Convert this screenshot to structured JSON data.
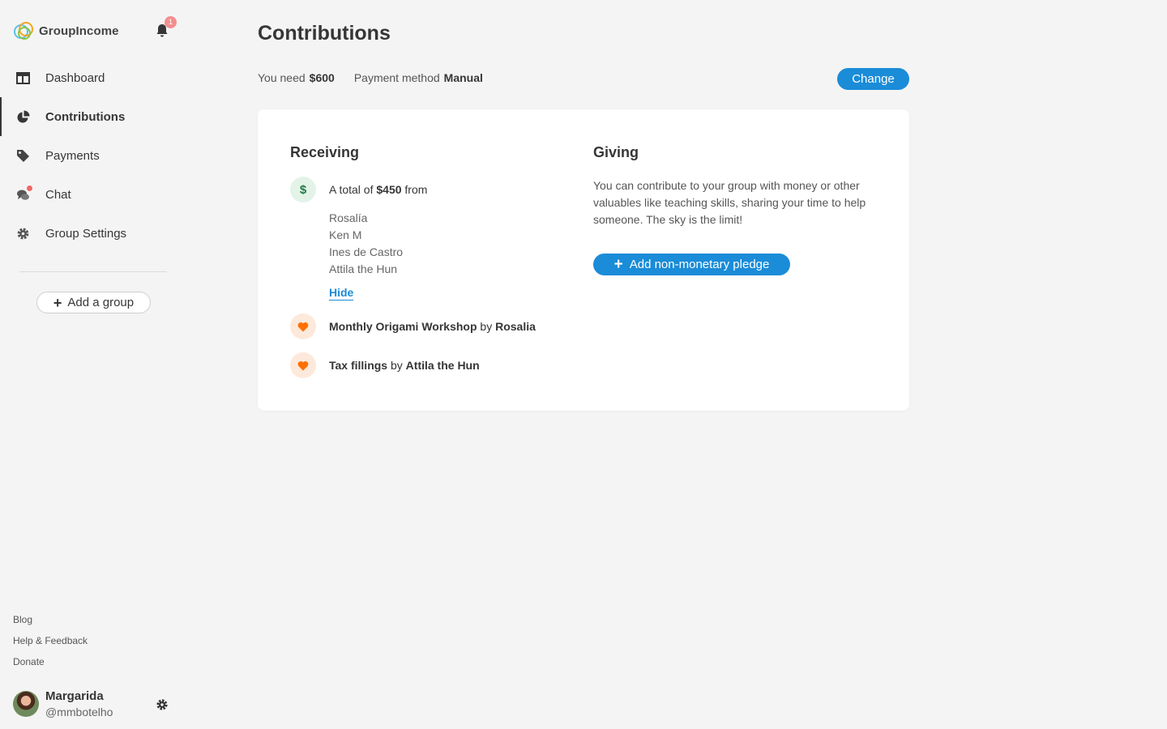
{
  "sidebar": {
    "brand": "GroupIncome",
    "notification_count": "1",
    "nav": [
      {
        "label": "Dashboard",
        "icon": "dashboard-icon"
      },
      {
        "label": "Contributions",
        "icon": "pie-chart-icon",
        "active": true
      },
      {
        "label": "Payments",
        "icon": "tag-icon"
      },
      {
        "label": "Chat",
        "icon": "chat-icon",
        "unread": true
      },
      {
        "label": "Group Settings",
        "icon": "gear-icon"
      }
    ],
    "add_group": "Add a group",
    "footer_links": [
      "Blog",
      "Help & Feedback",
      "Donate"
    ],
    "profile": {
      "name": "Margarida",
      "handle": "@mmbotelho"
    }
  },
  "main": {
    "title": "Contributions",
    "summary": {
      "need_label": "You need",
      "need_value": "$600",
      "method_label": "Payment method",
      "method_value": "Manual",
      "change_button": "Change"
    },
    "receiving": {
      "title": "Receiving",
      "total_prefix": "A total of",
      "total_value": "$450",
      "total_suffix": "from",
      "donors": [
        "Rosalía",
        "Ken M",
        "Ines de Castro",
        "Attila the Hun"
      ],
      "hide_link": "Hide",
      "pledges": [
        {
          "what": "Monthly Origami Workshop",
          "by": "by",
          "who": "Rosalia"
        },
        {
          "what": "Tax fillings",
          "by": "by",
          "who": "Attila the Hun"
        }
      ]
    },
    "giving": {
      "title": "Giving",
      "description": "You can contribute to your group with money or other valuables like teaching skills, sharing your time to help someone. The sky is the limit!",
      "pledge_button": "Add non-monetary pledge"
    }
  },
  "colors": {
    "accent": "#1a8cd8",
    "badge": "#f38e8e",
    "money_bg": "#e3f3e8",
    "heart": "#ff6f00",
    "heart_bg": "#fde9db"
  }
}
